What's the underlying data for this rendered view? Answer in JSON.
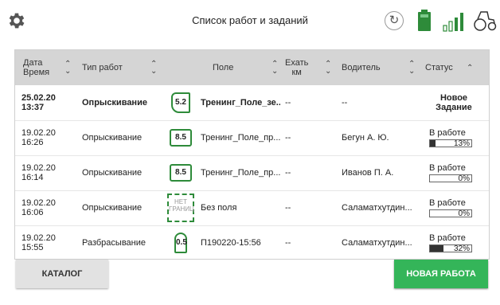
{
  "header": {
    "title": "Список работ и заданий",
    "icons": [
      "settings-gear",
      "sync",
      "battery",
      "signal",
      "tractor"
    ]
  },
  "table": {
    "columns": {
      "datetime": "Дата Время",
      "work_type": "Тип работ",
      "field": "Поле",
      "distance": "Ехать км",
      "driver": "Водитель",
      "status": "Статус"
    },
    "rows": [
      {
        "date": "25.02.20",
        "time": "13:37",
        "work_type": "Опрыскивание",
        "field_badge": "5.2",
        "field_name": "Тренинг_Поле_зе...",
        "distance": "--",
        "driver": "--",
        "status": "Новое Задание",
        "progress": null
      },
      {
        "date": "19.02.20",
        "time": "16:26",
        "work_type": "Опрыскивание",
        "field_badge": "8.5",
        "field_name": "Тренинг_Поле_пр...",
        "distance": "--",
        "driver": "Бегун А. Ю.",
        "status": "В работе",
        "progress": "13%"
      },
      {
        "date": "19.02.20",
        "time": "16:14",
        "work_type": "Опрыскивание",
        "field_badge": "8.5",
        "field_name": "Тренинг_Поле_пр...",
        "distance": "--",
        "driver": "Иванов П. А.",
        "status": "В работе",
        "progress": "0%"
      },
      {
        "date": "19.02.20",
        "time": "16:06",
        "work_type": "Опрыскивание",
        "field_badge": "НЕТ ГРАНИЦ",
        "field_name": "Без поля",
        "distance": "--",
        "driver": "Саламатхутдин...",
        "status": "В работе",
        "progress": "0%"
      },
      {
        "date": "19.02.20",
        "time": "15:55",
        "work_type": "Разбрасывание",
        "field_badge": "0.5",
        "field_name": "П190220-15:56",
        "distance": "--",
        "driver": "Саламатхутдин...",
        "status": "В работе",
        "progress": "32%"
      }
    ]
  },
  "buttons": {
    "catalog": "КАТАЛОГ",
    "new_job": "НОВАЯ РАБОТА"
  },
  "colors": {
    "accent_green": "#34b559",
    "field_border_green": "#2e8b3a",
    "header_gray": "#d5d5d5"
  }
}
